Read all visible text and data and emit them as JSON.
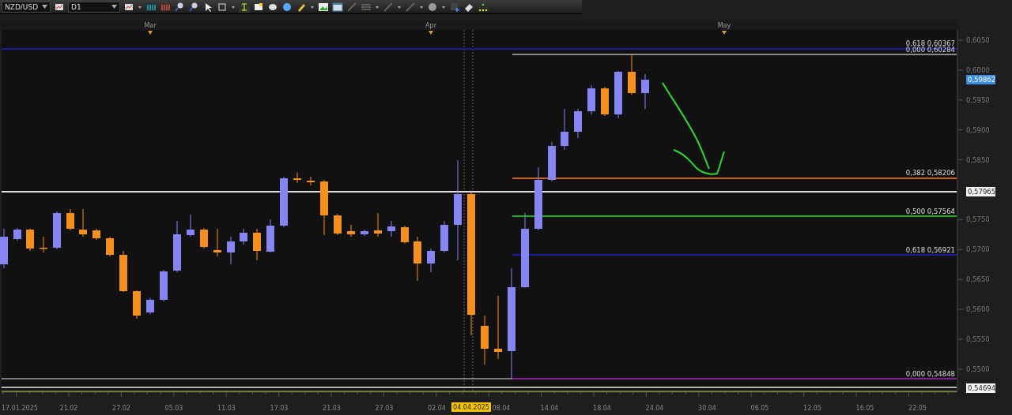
{
  "toolbar": {
    "symbol": "NZD/USD",
    "timeframe": "D1"
  },
  "chart": {
    "month_labels": [
      "Mar",
      "Apr",
      "May"
    ],
    "fib_levels": [
      {
        "label": "0,618 0,60367",
        "color": "#1a1a9a"
      },
      {
        "label": "0,000 0,60284",
        "color": "#8a8a8a"
      },
      {
        "label": "0,382 0,58206",
        "color": "#c8641e"
      },
      {
        "label": "0,500 0,57564",
        "color": "#22b022"
      },
      {
        "label": "0,618 0,56921",
        "color": "#1a1a9a"
      },
      {
        "label": "0,000 0,54848",
        "color": "#8a1a9a"
      }
    ],
    "price_labels": [
      "0,6050",
      "0,6000",
      "0,5950",
      "0,5900",
      "0,5850",
      "0,5750",
      "0,5700",
      "0,5650",
      "0,5600",
      "0,5550",
      "0,5500"
    ],
    "price_badges": [
      {
        "text": "0,59862",
        "kind": "bid"
      },
      {
        "text": "0,57965",
        "kind": "line"
      },
      {
        "text": "0,54694",
        "kind": "line"
      }
    ],
    "date_labels": [
      {
        "text": "17.01.2025",
        "selected": false
      },
      {
        "text": "21.02",
        "selected": false
      },
      {
        "text": "27.02",
        "selected": false
      },
      {
        "text": "05.03",
        "selected": false
      },
      {
        "text": "11.03",
        "selected": false
      },
      {
        "text": "17.03",
        "selected": false
      },
      {
        "text": "21.03",
        "selected": false
      },
      {
        "text": "27.03",
        "selected": false
      },
      {
        "text": "02.04",
        "selected": false
      },
      {
        "text": "04.04.2025",
        "selected": true
      },
      {
        "text": "08.04",
        "selected": false
      },
      {
        "text": "14.04",
        "selected": false
      },
      {
        "text": "18.04",
        "selected": false
      },
      {
        "text": "24.04",
        "selected": false
      },
      {
        "text": "30.04",
        "selected": false
      },
      {
        "text": "06.05",
        "selected": false
      },
      {
        "text": "12.05",
        "selected": false
      },
      {
        "text": "16.05",
        "selected": false
      },
      {
        "text": "22.05",
        "selected": false
      }
    ]
  }
}
